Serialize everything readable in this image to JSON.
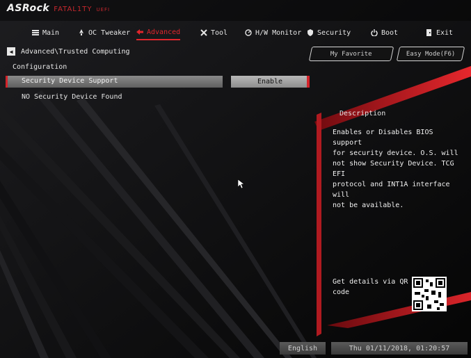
{
  "brand": {
    "logo": "ASRock",
    "series": "FATAL1TY",
    "uefi": "UEFI"
  },
  "nav": [
    {
      "label": "Main",
      "icon": "list-icon",
      "active": false
    },
    {
      "label": "OC Tweaker",
      "icon": "rocket-icon",
      "active": false
    },
    {
      "label": "Advanced",
      "icon": "arrow-icon",
      "active": true
    },
    {
      "label": "Tool",
      "icon": "tool-icon",
      "active": false
    },
    {
      "label": "H/W Monitor",
      "icon": "monitor-icon",
      "active": false
    },
    {
      "label": "Security",
      "icon": "shield-icon",
      "active": false
    },
    {
      "label": "Boot",
      "icon": "power-icon",
      "active": false
    },
    {
      "label": "Exit",
      "icon": "exit-icon",
      "active": false
    }
  ],
  "breadcrumb": {
    "back_icon": "back-arrow-icon",
    "path": "Advanced\\Trusted Computing"
  },
  "favorite": {
    "label": "My Favorite"
  },
  "easy_mode": {
    "label": "Easy Mode(F6)"
  },
  "section": {
    "title": "Configuration"
  },
  "settings": [
    {
      "label": "Security Device Support",
      "value": "Enable"
    }
  ],
  "info_line": "NO Security Device Found",
  "description": {
    "title": "Description",
    "lines": [
      "Enables or Disables BIOS support",
      "for security device. O.S. will",
      "not show Security Device. TCG EFI",
      "protocol and INT1A interface will",
      "not be available."
    ]
  },
  "qr": {
    "label_lines": [
      "Get details via QR",
      "code"
    ]
  },
  "footer": {
    "language": "English",
    "datetime": "Thu 01/11/2018, 01:20:57"
  },
  "colors": {
    "accent": "#e0262c",
    "background": "#0b0b0c",
    "text": "#e6e6e6"
  }
}
